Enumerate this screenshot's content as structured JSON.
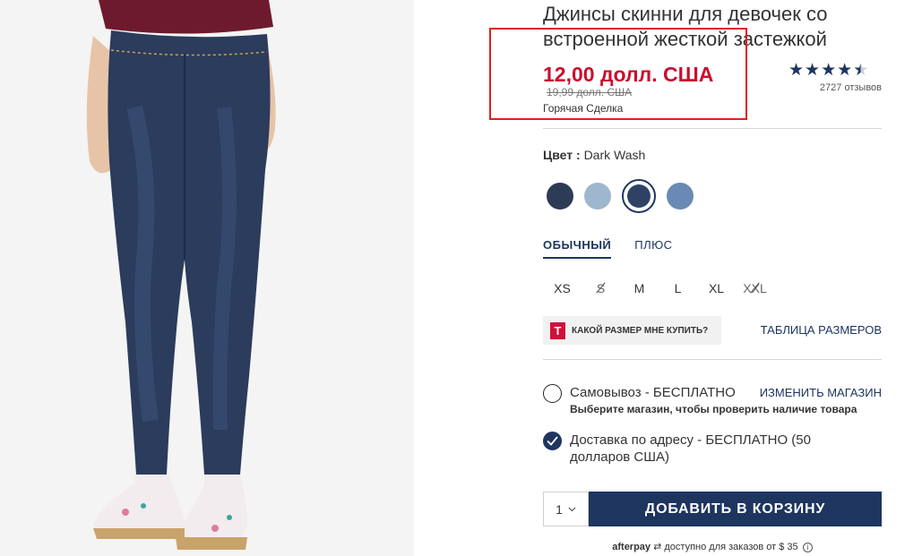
{
  "product": {
    "title": "Джинсы скинни для девочек со встроенной жесткой застежкой",
    "price_sale": "12,00 долл. США",
    "price_original": "19,99 долл. США",
    "deal_label": "Горячая Сделка",
    "rating_value": 4.5,
    "reviews": "2727 отзывов"
  },
  "color": {
    "label": "Цвет :",
    "selected": "Dark Wash",
    "swatches": [
      {
        "name": "dark-rinse",
        "hex": "#2d3b57"
      },
      {
        "name": "light-wash",
        "hex": "#9fb6cf"
      },
      {
        "name": "dark-wash",
        "hex": "#2f4266"
      },
      {
        "name": "medium-wash",
        "hex": "#6a89b4"
      }
    ]
  },
  "fit_tabs": [
    {
      "label": "ОБЫЧНЫЙ",
      "active": true
    },
    {
      "label": "ПЛЮС",
      "active": false
    }
  ],
  "sizes": [
    {
      "label": "XS",
      "available": true
    },
    {
      "label": "S",
      "available": false
    },
    {
      "label": "M",
      "available": true
    },
    {
      "label": "L",
      "available": true
    },
    {
      "label": "XL",
      "available": true
    },
    {
      "label": "XXL",
      "available": false
    }
  ],
  "fit_finder": {
    "logo": "T",
    "label": "КАКОЙ РАЗМЕР МНЕ КУПИТЬ?"
  },
  "size_chart": "ТАБЛИЦА РАЗМЕРОВ",
  "fulfillment": {
    "pickup_label": "Самовывоз - БЕСПЛАТНО",
    "pickup_sub": "Выберите магазин, чтобы проверить наличие товара",
    "change_store": "ИЗМЕНИТЬ МАГАЗИН",
    "ship_label": "Доставка по адресу - БЕСПЛАТНО (50 долларов США)"
  },
  "cart": {
    "qty": "1",
    "add_label": "ДОБАВИТЬ В КОРЗИНУ"
  },
  "afterpay": {
    "logo": "afterpay",
    "text": "доступно для заказов от $ 35"
  },
  "colors": {
    "brand_navy": "#1e3560",
    "sale_red": "#c8102e",
    "highlight_box": "#e02020"
  }
}
